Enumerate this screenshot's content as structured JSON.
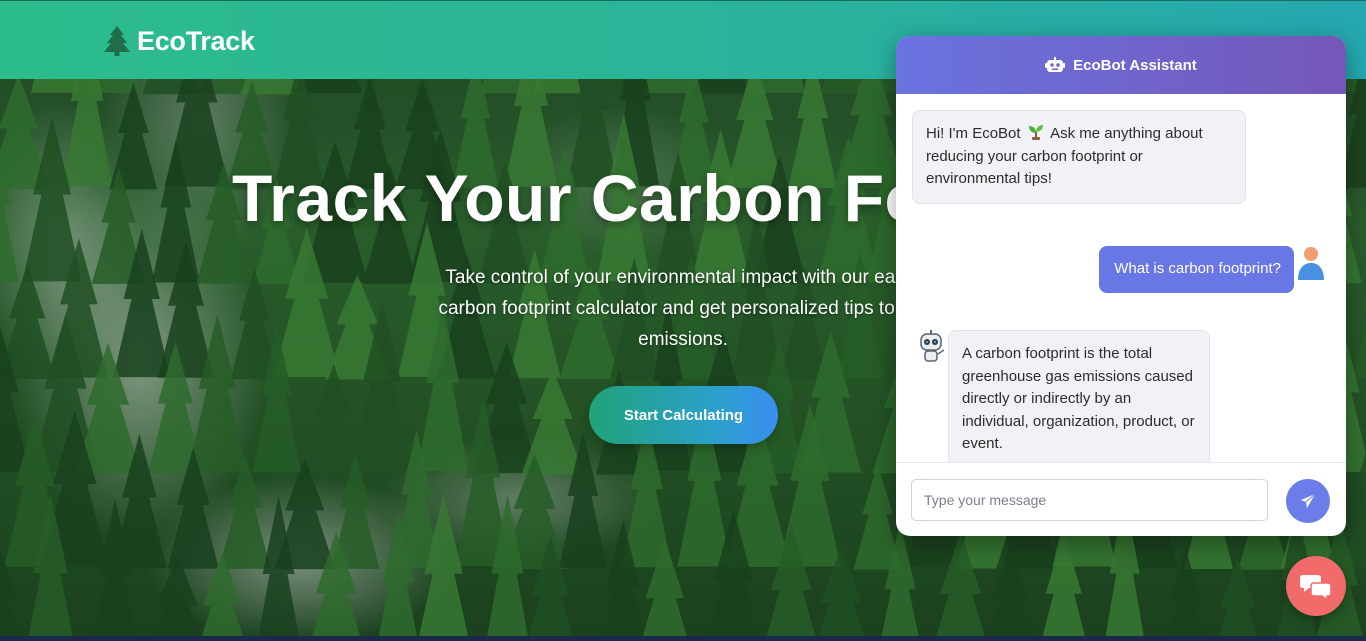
{
  "navbar": {
    "brand": "EcoTrack",
    "brand_icon": "tree-icon",
    "background_gradient": [
      "#2cbc8c",
      "#25a8b0"
    ]
  },
  "hero": {
    "title": "Track Your Carbon Fo",
    "subtitle_lines": [
      "Take control of your environmental impact with our easy-",
      "carbon footprint calculator and get personalized tips to red",
      "emissions."
    ],
    "cta_label": "Start Calculating",
    "cta_gradient": [
      "#1fa37a",
      "#3a8ef0"
    ]
  },
  "chat": {
    "header_title": "EcoBot Assistant",
    "header_icon": "robot-icon",
    "header_gradient": [
      "#6a73e0",
      "#7457b8"
    ],
    "messages": [
      {
        "sender": "bot",
        "text_before": "Hi! I'm EcoBot",
        "emoji_icon": "seedling-icon",
        "text_after": "Ask me anything about reducing your carbon footprint or environmental tips!"
      },
      {
        "sender": "user",
        "text": "What is carbon footprint?",
        "avatar": "user-avatar-icon"
      },
      {
        "sender": "bot",
        "text": "A carbon footprint is the total greenhouse gas emissions caused directly or indirectly by an individual, organization, product, or event.",
        "avatar": "bot-avatar-icon"
      }
    ],
    "input_placeholder": "Type your message",
    "input_value": "",
    "send_icon": "paper-plane-icon",
    "user_bubble_color": "#6976e6",
    "send_color": "#6c7de9"
  },
  "toggle": {
    "icon": "chat-bubbles-icon",
    "color": "#f26b6b"
  }
}
